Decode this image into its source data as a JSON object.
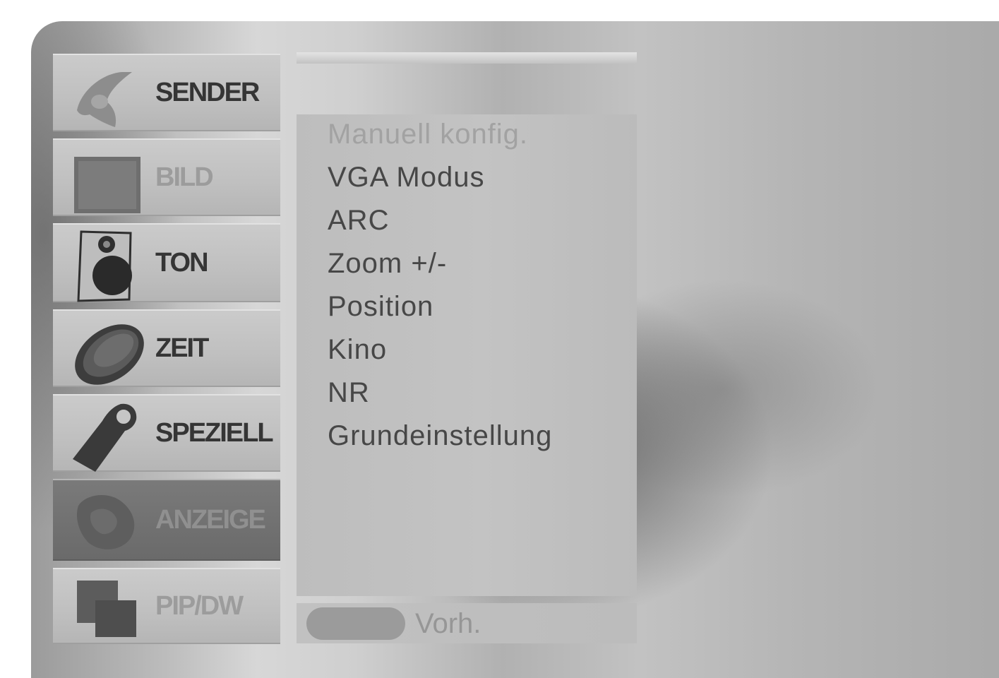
{
  "menu": {
    "tabs": [
      {
        "label": "SENDER",
        "icon": "satellite-icon",
        "state": "normal"
      },
      {
        "label": "BILD",
        "icon": "picture-icon",
        "state": "active"
      },
      {
        "label": "TON",
        "icon": "speaker-icon",
        "state": "normal"
      },
      {
        "label": "ZEIT",
        "icon": "clock-icon",
        "state": "normal"
      },
      {
        "label": "SPEZIELL",
        "icon": "tag-icon",
        "state": "normal"
      },
      {
        "label": "ANZEIGE",
        "icon": "display-icon",
        "state": "highlighted"
      },
      {
        "label": "PIP/DW",
        "icon": "pip-icon",
        "state": "active"
      }
    ]
  },
  "submenu": {
    "items": [
      "Manuell konfig.",
      "VGA Modus",
      "ARC",
      "Zoom +/-",
      "Position",
      "Kino",
      "NR",
      "Grundeinstellung"
    ]
  },
  "footer": {
    "prev_label": "Vorh."
  }
}
